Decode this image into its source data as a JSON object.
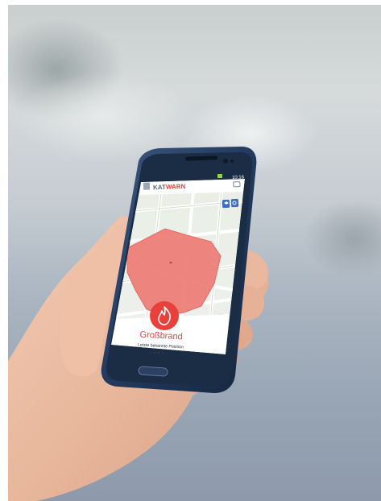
{
  "app": {
    "logo_part1": "KAT",
    "logo_part2": "WARN",
    "logo_color1": "#5a6a7a",
    "logo_color2": "#e8403a",
    "status_time": "10:16"
  },
  "alert": {
    "title": "Großbrand",
    "subtitle": "Letzte bekannte Position",
    "accent_color": "#e8403a",
    "icon": "fire-icon",
    "page_count": 4,
    "page_active": 0
  },
  "map": {
    "area_color": "#ee7b74",
    "icons": [
      "layers-icon",
      "locate-icon"
    ]
  }
}
